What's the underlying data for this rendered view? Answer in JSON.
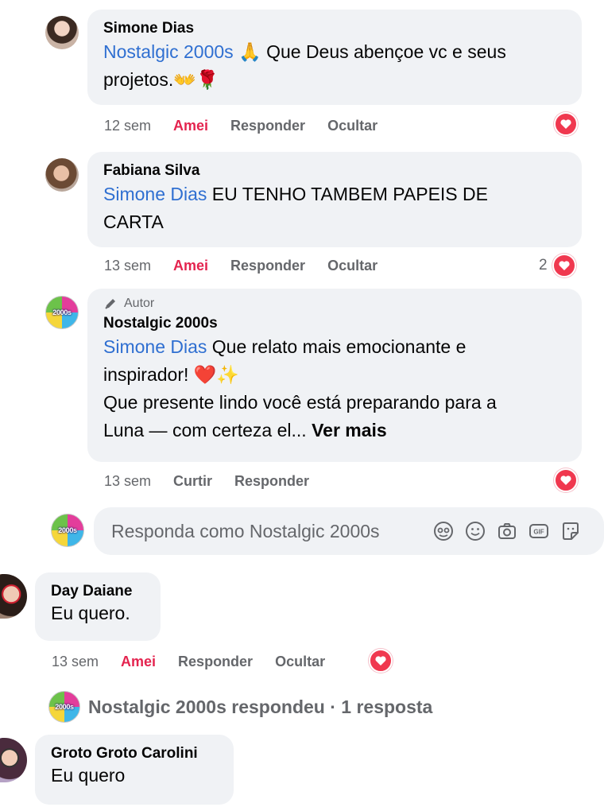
{
  "comments": [
    {
      "author": "Simone Dias",
      "mention": "Nostalgic 2000s",
      "text_line1": " 🙏 Que Deus abençoe vc e seus",
      "text_line2": "projetos.👐🌹",
      "time": "12 sem",
      "love_label": "Amei",
      "reply_label": "Responder",
      "hide_label": "Ocultar"
    },
    {
      "author": "Fabiana Silva",
      "mention": "Simone Dias",
      "text_line1": " EU TENHO TAMBEM PAPEIS DE",
      "text_line2": "CARTA",
      "time": "13 sem",
      "love_label": "Amei",
      "reply_label": "Responder",
      "hide_label": "Ocultar",
      "reaction_count": "2"
    },
    {
      "badge": "Autor",
      "author": "Nostalgic 2000s",
      "mention": "Simone Dias",
      "text_line1": " Que relato mais emocionante e",
      "text_line2": "inspirador! ❤️✨",
      "text_line3": "Que presente lindo você está preparando para a",
      "text_line4": "Luna — com certeza el...",
      "see_more": "Ver mais",
      "time": "13 sem",
      "like_label": "Curtir",
      "reply_label": "Responder"
    },
    {
      "author": "Day Daiane",
      "text": "Eu quero.",
      "time": "13 sem",
      "love_label": "Amei",
      "reply_label": "Responder",
      "hide_label": "Ocultar"
    },
    {
      "author": "Groto Groto Carolini",
      "text": "Eu quero"
    }
  ],
  "reply_box": {
    "placeholder": "Responda como Nostalgic 2000s",
    "icons": [
      "avatar-sticker-icon",
      "emoji-icon",
      "camera-icon",
      "gif-icon",
      "sticker-icon"
    ]
  },
  "replies_link": "Nostalgic 2000s respondeu · 1 resposta",
  "avatar_logo_text": "2000s",
  "colors": {
    "mention": "#2f6fd1",
    "love": "#e4244f",
    "bubble": "#f0f2f5",
    "meta": "#65676b"
  }
}
